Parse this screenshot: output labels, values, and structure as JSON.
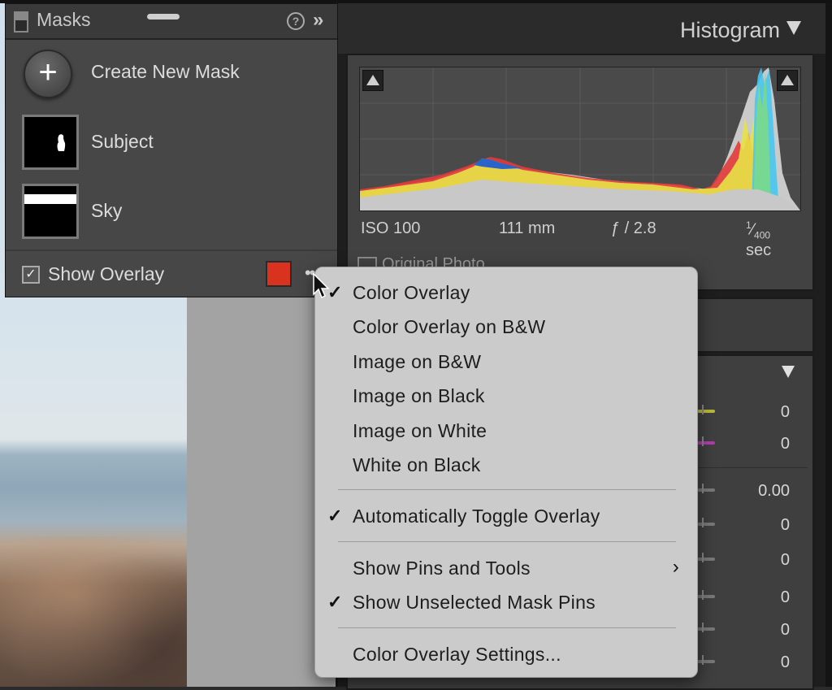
{
  "masks_panel": {
    "title": "Masks",
    "create_label": "Create New Mask",
    "create_symbol": "+",
    "masks": [
      {
        "label": "Subject"
      },
      {
        "label": "Sky"
      }
    ],
    "show_overlay_label": "Show Overlay",
    "show_overlay_checked": true,
    "overlay_color": "#d9331f",
    "help_symbol": "?",
    "collapse_symbol": "»"
  },
  "histogram": {
    "title": "Histogram",
    "iso": "ISO 100",
    "focal_length": "111 mm",
    "aperture": "ƒ / 2.8",
    "shutter_num": "1",
    "shutter_den": "400",
    "shutter_unit": "sec",
    "original_photo_label": "Original Photo"
  },
  "slider_values": [
    "0",
    "0",
    "0.00",
    "0",
    "0",
    "0",
    "0",
    "0"
  ],
  "overlay_menu": {
    "items": [
      {
        "label": "Color Overlay",
        "checked": true
      },
      {
        "label": "Color Overlay on B&W",
        "checked": false
      },
      {
        "label": "Image on B&W",
        "checked": false
      },
      {
        "label": "Image on Black",
        "checked": false
      },
      {
        "label": "Image on White",
        "checked": false
      },
      {
        "label": "White on Black",
        "checked": false
      },
      {
        "label": "Automatically Toggle Overlay",
        "checked": true
      },
      {
        "label": "Show Pins and Tools",
        "checked": false,
        "submenu": true
      },
      {
        "label": "Show Unselected Mask Pins",
        "checked": true
      },
      {
        "label": "Color Overlay Settings...",
        "checked": false
      }
    ],
    "check_symbol": "✓",
    "submenu_symbol": "›"
  }
}
